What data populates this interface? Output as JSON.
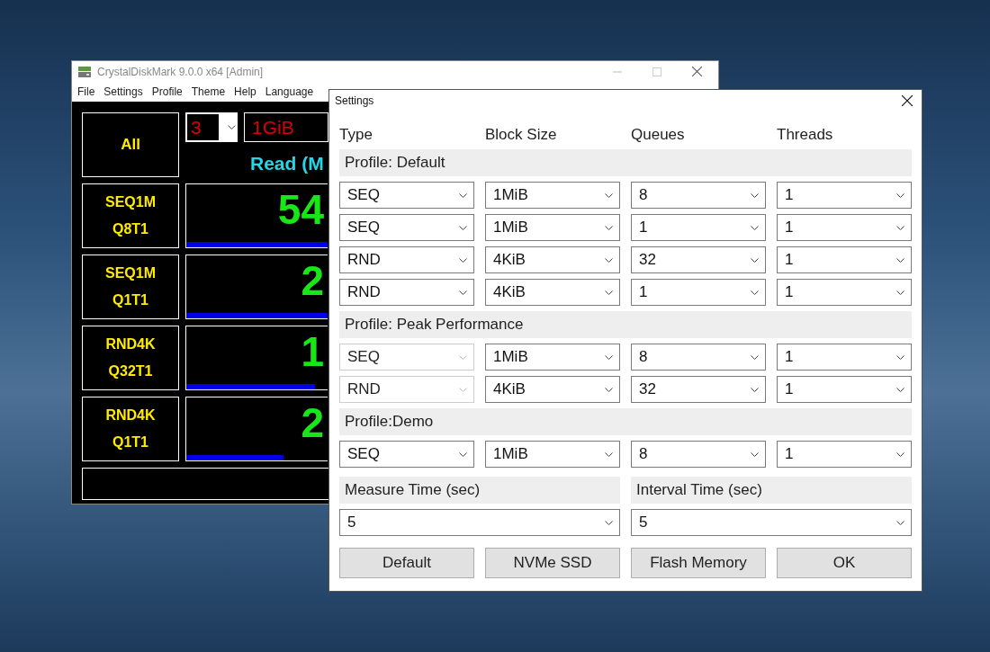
{
  "main_window": {
    "title": "CrystalDiskMark 9.0.0 x64 [Admin]",
    "menu": [
      "File",
      "Settings",
      "Profile",
      "Theme",
      "Help",
      "Language"
    ],
    "all_button": "All",
    "count": "3",
    "size": "1GiB",
    "read_header": "Read (M",
    "tests": [
      {
        "line1": "SEQ1M",
        "line2": "Q8T1",
        "result": "54",
        "level": 1.0
      },
      {
        "line1": "SEQ1M",
        "line2": "Q1T1",
        "result": "2",
        "level": 1.0
      },
      {
        "line1": "RND4K",
        "line2": "Q32T1",
        "result": "1",
        "level": 0.91
      },
      {
        "line1": "RND4K",
        "line2": "Q1T1",
        "result": "2",
        "level": 0.69
      }
    ]
  },
  "settings_dialog": {
    "title": "Settings",
    "columns": [
      "Type",
      "Block Size",
      "Queues",
      "Threads"
    ],
    "profiles": [
      {
        "label": "Profile: Default",
        "rows": [
          {
            "cells": [
              {
                "value": "SEQ",
                "disabled": false
              },
              {
                "value": "1MiB",
                "disabled": false
              },
              {
                "value": "8",
                "disabled": false
              },
              {
                "value": "1",
                "disabled": false
              }
            ]
          },
          {
            "cells": [
              {
                "value": "SEQ",
                "disabled": false
              },
              {
                "value": "1MiB",
                "disabled": false
              },
              {
                "value": "1",
                "disabled": false
              },
              {
                "value": "1",
                "disabled": false
              }
            ]
          },
          {
            "cells": [
              {
                "value": "RND",
                "disabled": false
              },
              {
                "value": "4KiB",
                "disabled": false
              },
              {
                "value": "32",
                "disabled": false
              },
              {
                "value": "1",
                "disabled": false
              }
            ]
          },
          {
            "cells": [
              {
                "value": "RND",
                "disabled": false
              },
              {
                "value": "4KiB",
                "disabled": false
              },
              {
                "value": "1",
                "disabled": false
              },
              {
                "value": "1",
                "disabled": false
              }
            ]
          }
        ]
      },
      {
        "label": "Profile: Peak Performance",
        "rows": [
          {
            "cells": [
              {
                "value": "SEQ",
                "disabled": true
              },
              {
                "value": "1MiB",
                "disabled": false
              },
              {
                "value": "8",
                "disabled": false
              },
              {
                "value": "1",
                "disabled": false
              }
            ]
          },
          {
            "cells": [
              {
                "value": "RND",
                "disabled": true
              },
              {
                "value": "4KiB",
                "disabled": false
              },
              {
                "value": "32",
                "disabled": false
              },
              {
                "value": "1",
                "disabled": false
              }
            ]
          }
        ]
      },
      {
        "label": "Profile:Demo",
        "rows": [
          {
            "cells": [
              {
                "value": "SEQ",
                "disabled": false
              },
              {
                "value": "1MiB",
                "disabled": false
              },
              {
                "value": "8",
                "disabled": false
              },
              {
                "value": "1",
                "disabled": false
              }
            ]
          }
        ]
      }
    ],
    "timings": [
      {
        "label": "Measure Time (sec)",
        "value": "5"
      },
      {
        "label": "Interval Time (sec)",
        "value": "5"
      }
    ],
    "buttons": [
      "Default",
      "NVMe SSD",
      "Flash Memory",
      "OK"
    ]
  }
}
